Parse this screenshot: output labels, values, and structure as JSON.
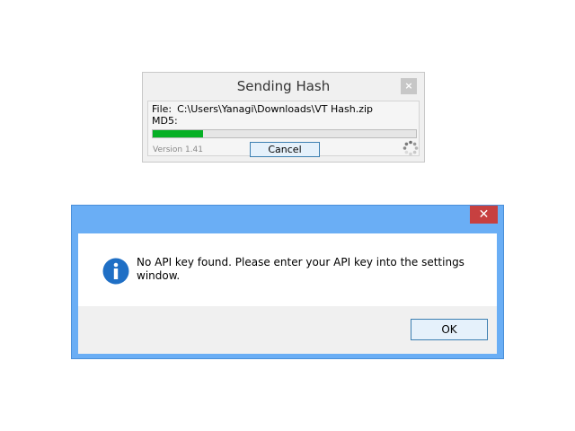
{
  "hash_dialog": {
    "title": "Sending Hash",
    "close_glyph": "×",
    "file_label": "File:",
    "file_path": "C:\\Users\\Yanagi\\Downloads\\VT Hash.zip",
    "md5_label": "MD5:",
    "progress_fraction": 0.19,
    "progress_color": "#06b025",
    "version": "Version 1.41",
    "cancel_label": "Cancel",
    "busy_icon": "spinner-icon"
  },
  "message_box": {
    "close_glyph": "✕",
    "icon": "info-icon",
    "message": "No API key found. Please enter your API key into the settings window.",
    "ok_label": "OK",
    "title_bar_color": "#6aaef5",
    "close_button_color": "#c74040"
  }
}
